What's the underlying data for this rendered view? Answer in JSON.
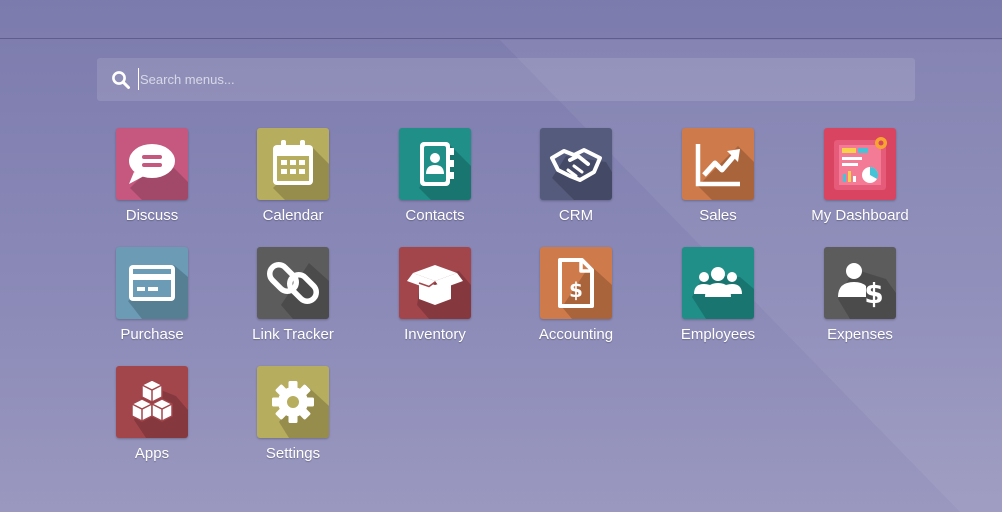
{
  "search": {
    "placeholder": "Search menus..."
  },
  "apps": [
    {
      "label": "Discuss",
      "icon": "speech-bubble-icon",
      "color": "#c6587f"
    },
    {
      "label": "Calendar",
      "icon": "calendar-icon",
      "color": "#b7ad5e"
    },
    {
      "label": "Contacts",
      "icon": "address-book-icon",
      "color": "#1f8f88"
    },
    {
      "label": "CRM",
      "icon": "handshake-icon",
      "color": "#545b7c"
    },
    {
      "label": "Sales",
      "icon": "trend-chart-icon",
      "color": "#cf7a4a"
    },
    {
      "label": "My Dashboard",
      "icon": "dashboard-icon",
      "color": "#d94561"
    },
    {
      "label": "Purchase",
      "icon": "credit-card-icon",
      "color": "#6b9bb5"
    },
    {
      "label": "Link Tracker",
      "icon": "chain-link-icon",
      "color": "#5c5c5c"
    },
    {
      "label": "Inventory",
      "icon": "open-box-icon",
      "color": "#a3464c"
    },
    {
      "label": "Accounting",
      "icon": "invoice-dollar-icon",
      "color": "#cf7a4a"
    },
    {
      "label": "Employees",
      "icon": "people-group-icon",
      "color": "#1f8f88"
    },
    {
      "label": "Expenses",
      "icon": "user-dollar-icon",
      "color": "#5c5c5c"
    },
    {
      "label": "Apps",
      "icon": "cubes-icon",
      "color": "#a3464c"
    },
    {
      "label": "Settings",
      "icon": "gear-icon",
      "color": "#b7ad5e"
    }
  ]
}
